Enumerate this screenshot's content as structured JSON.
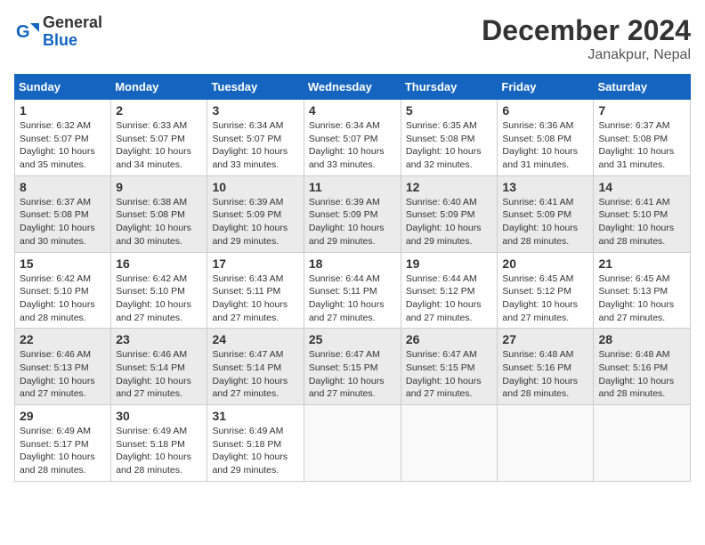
{
  "header": {
    "logo_line1": "General",
    "logo_line2": "Blue",
    "month_title": "December 2024",
    "location": "Janakpur, Nepal"
  },
  "weekdays": [
    "Sunday",
    "Monday",
    "Tuesday",
    "Wednesday",
    "Thursday",
    "Friday",
    "Saturday"
  ],
  "weeks": [
    [
      {
        "day": "1",
        "info": "Sunrise: 6:32 AM\nSunset: 5:07 PM\nDaylight: 10 hours\nand 35 minutes."
      },
      {
        "day": "2",
        "info": "Sunrise: 6:33 AM\nSunset: 5:07 PM\nDaylight: 10 hours\nand 34 minutes."
      },
      {
        "day": "3",
        "info": "Sunrise: 6:34 AM\nSunset: 5:07 PM\nDaylight: 10 hours\nand 33 minutes."
      },
      {
        "day": "4",
        "info": "Sunrise: 6:34 AM\nSunset: 5:07 PM\nDaylight: 10 hours\nand 33 minutes."
      },
      {
        "day": "5",
        "info": "Sunrise: 6:35 AM\nSunset: 5:08 PM\nDaylight: 10 hours\nand 32 minutes."
      },
      {
        "day": "6",
        "info": "Sunrise: 6:36 AM\nSunset: 5:08 PM\nDaylight: 10 hours\nand 31 minutes."
      },
      {
        "day": "7",
        "info": "Sunrise: 6:37 AM\nSunset: 5:08 PM\nDaylight: 10 hours\nand 31 minutes."
      }
    ],
    [
      {
        "day": "8",
        "info": "Sunrise: 6:37 AM\nSunset: 5:08 PM\nDaylight: 10 hours\nand 30 minutes."
      },
      {
        "day": "9",
        "info": "Sunrise: 6:38 AM\nSunset: 5:08 PM\nDaylight: 10 hours\nand 30 minutes."
      },
      {
        "day": "10",
        "info": "Sunrise: 6:39 AM\nSunset: 5:09 PM\nDaylight: 10 hours\nand 29 minutes."
      },
      {
        "day": "11",
        "info": "Sunrise: 6:39 AM\nSunset: 5:09 PM\nDaylight: 10 hours\nand 29 minutes."
      },
      {
        "day": "12",
        "info": "Sunrise: 6:40 AM\nSunset: 5:09 PM\nDaylight: 10 hours\nand 29 minutes."
      },
      {
        "day": "13",
        "info": "Sunrise: 6:41 AM\nSunset: 5:09 PM\nDaylight: 10 hours\nand 28 minutes."
      },
      {
        "day": "14",
        "info": "Sunrise: 6:41 AM\nSunset: 5:10 PM\nDaylight: 10 hours\nand 28 minutes."
      }
    ],
    [
      {
        "day": "15",
        "info": "Sunrise: 6:42 AM\nSunset: 5:10 PM\nDaylight: 10 hours\nand 28 minutes."
      },
      {
        "day": "16",
        "info": "Sunrise: 6:42 AM\nSunset: 5:10 PM\nDaylight: 10 hours\nand 27 minutes."
      },
      {
        "day": "17",
        "info": "Sunrise: 6:43 AM\nSunset: 5:11 PM\nDaylight: 10 hours\nand 27 minutes."
      },
      {
        "day": "18",
        "info": "Sunrise: 6:44 AM\nSunset: 5:11 PM\nDaylight: 10 hours\nand 27 minutes."
      },
      {
        "day": "19",
        "info": "Sunrise: 6:44 AM\nSunset: 5:12 PM\nDaylight: 10 hours\nand 27 minutes."
      },
      {
        "day": "20",
        "info": "Sunrise: 6:45 AM\nSunset: 5:12 PM\nDaylight: 10 hours\nand 27 minutes."
      },
      {
        "day": "21",
        "info": "Sunrise: 6:45 AM\nSunset: 5:13 PM\nDaylight: 10 hours\nand 27 minutes."
      }
    ],
    [
      {
        "day": "22",
        "info": "Sunrise: 6:46 AM\nSunset: 5:13 PM\nDaylight: 10 hours\nand 27 minutes."
      },
      {
        "day": "23",
        "info": "Sunrise: 6:46 AM\nSunset: 5:14 PM\nDaylight: 10 hours\nand 27 minutes."
      },
      {
        "day": "24",
        "info": "Sunrise: 6:47 AM\nSunset: 5:14 PM\nDaylight: 10 hours\nand 27 minutes."
      },
      {
        "day": "25",
        "info": "Sunrise: 6:47 AM\nSunset: 5:15 PM\nDaylight: 10 hours\nand 27 minutes."
      },
      {
        "day": "26",
        "info": "Sunrise: 6:47 AM\nSunset: 5:15 PM\nDaylight: 10 hours\nand 27 minutes."
      },
      {
        "day": "27",
        "info": "Sunrise: 6:48 AM\nSunset: 5:16 PM\nDaylight: 10 hours\nand 28 minutes."
      },
      {
        "day": "28",
        "info": "Sunrise: 6:48 AM\nSunset: 5:16 PM\nDaylight: 10 hours\nand 28 minutes."
      }
    ],
    [
      {
        "day": "29",
        "info": "Sunrise: 6:49 AM\nSunset: 5:17 PM\nDaylight: 10 hours\nand 28 minutes."
      },
      {
        "day": "30",
        "info": "Sunrise: 6:49 AM\nSunset: 5:18 PM\nDaylight: 10 hours\nand 28 minutes."
      },
      {
        "day": "31",
        "info": "Sunrise: 6:49 AM\nSunset: 5:18 PM\nDaylight: 10 hours\nand 29 minutes."
      },
      {
        "day": "",
        "info": ""
      },
      {
        "day": "",
        "info": ""
      },
      {
        "day": "",
        "info": ""
      },
      {
        "day": "",
        "info": ""
      }
    ]
  ]
}
